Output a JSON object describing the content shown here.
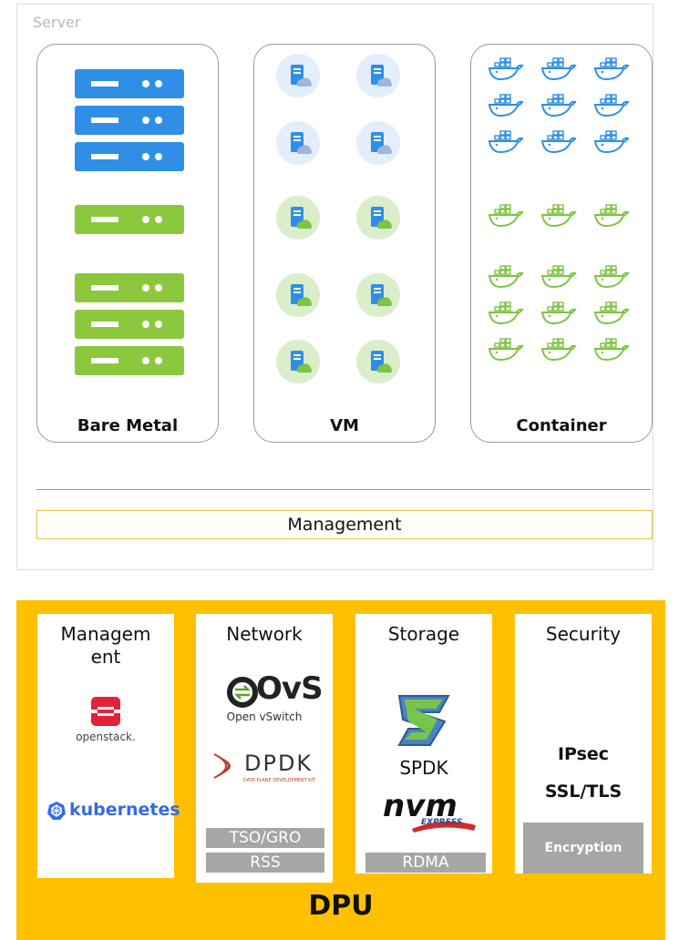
{
  "server": {
    "label": "Server",
    "panels": {
      "bare_metal": "Bare Metal",
      "vm": "VM",
      "container": "Container"
    },
    "management": "Management"
  },
  "dpu": {
    "label": "DPU",
    "cards": {
      "management": {
        "title": "Managem\nent",
        "openstack": "openstack.",
        "kubernetes": "kubernetes"
      },
      "network": {
        "title": "Network",
        "ovs": "OvS",
        "ovs_sub": "Open vSwitch",
        "dpdk": "DPDK",
        "dpdk_sub": "DATA PLANE DEVELOPMENT KIT",
        "tso": "TSO/GRO",
        "rss": "RSS"
      },
      "storage": {
        "title": "Storage",
        "spdk": "SPDK",
        "nvme": "nvm",
        "nvme_sub": "EXPRESS",
        "rdma": "RDMA"
      },
      "security": {
        "title": "Security",
        "ipsec": "IPsec",
        "ssl": "SSL/TLS",
        "encryption": "Encryption"
      }
    }
  },
  "colors": {
    "blue": "#2f8ee6",
    "green": "#8bc83e",
    "dpu_yellow": "#ffc000",
    "gray_bar": "#a6a6a6"
  },
  "icons": [
    "server-rack-icon",
    "vm-cloud-icon",
    "docker-whale-icon",
    "openstack-logo",
    "kubernetes-logo",
    "ovs-logo",
    "dpdk-logo",
    "spdk-logo",
    "nvme-logo"
  ]
}
